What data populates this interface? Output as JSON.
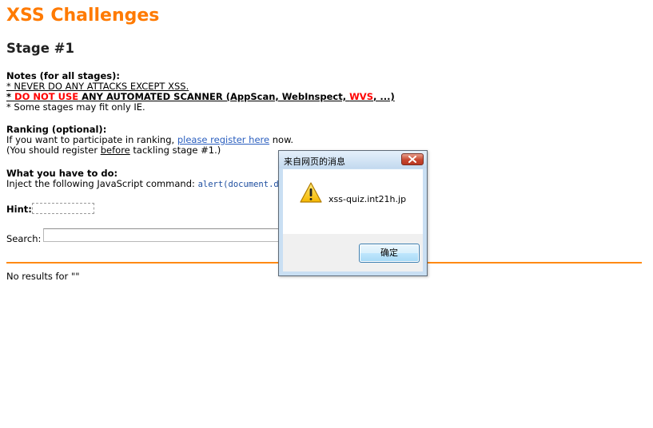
{
  "header": {
    "site_title": "XSS Challenges",
    "stage_title": "Stage #1"
  },
  "notes": {
    "heading": "Notes (for all stages):",
    "line1": "* NEVER DO ANY ATTACKS EXCEPT XSS.",
    "line2_prefix": "* ",
    "line2_red": "DO NOT USE",
    "line2_mid": " ANY AUTOMATED SCANNER (AppScan, WebInspect, ",
    "line2_red2": "WVS",
    "line2_end": ", ...)",
    "line3": "* Some stages may fit only IE."
  },
  "ranking": {
    "heading": "Ranking (optional):",
    "line1_prefix": "If you want to participate in ranking, ",
    "register_link": "please register here",
    "line1_suffix": " now.",
    "line2_prefix": "(You should register ",
    "line2_underlined": "before",
    "line2_suffix": " tackling stage #1.)"
  },
  "task": {
    "heading": "What you have to do:",
    "line_prefix": "Inject the following JavaScript command: ",
    "command": "alert(document.do"
  },
  "hint": {
    "label": "Hint:"
  },
  "search": {
    "label": "Search:",
    "value": ""
  },
  "results": {
    "text": "No results for \"\""
  },
  "dialog": {
    "title": "来自网页的消息",
    "message": "xss-quiz.int21h.jp",
    "ok_label": "确定",
    "icon": "warning-icon",
    "close_icon": "close-icon"
  },
  "colors": {
    "title_orange": "#ff7a00",
    "divider_orange": "#ff8a14",
    "warning_red": "#ff0000",
    "link_blue": "#2b5fbf"
  }
}
